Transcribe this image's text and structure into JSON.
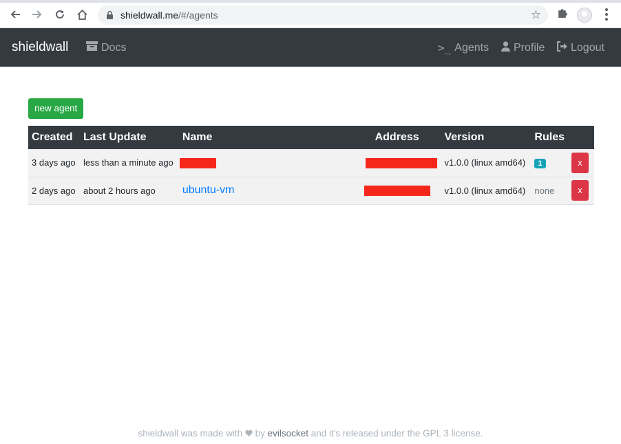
{
  "browser": {
    "url_host": "shieldwall.me",
    "url_path": "/#/agents"
  },
  "navbar": {
    "brand": "shieldwall",
    "docs": "Docs",
    "agents": "Agents",
    "profile": "Profile",
    "logout": "Logout"
  },
  "actions": {
    "new_agent": "new agent"
  },
  "table": {
    "headers": [
      "Created",
      "Last Update",
      "Name",
      "Address",
      "Version",
      "Rules"
    ],
    "rows": [
      {
        "created": "3 days ago",
        "last_update": "less than a minute ago",
        "name": "",
        "version": "v1.0.0 (linux amd64)",
        "rules": "1",
        "delete": "x"
      },
      {
        "created": "2 days ago",
        "last_update": "about 2 hours ago",
        "name": "ubuntu-vm",
        "version": "v1.0.0 (linux amd64)",
        "rules": "none",
        "delete": "x"
      }
    ]
  },
  "footer": {
    "before": "shieldwall was made with",
    "by": "by",
    "author": "evilsocket",
    "after": "and it's released under the GPL 3 license."
  }
}
